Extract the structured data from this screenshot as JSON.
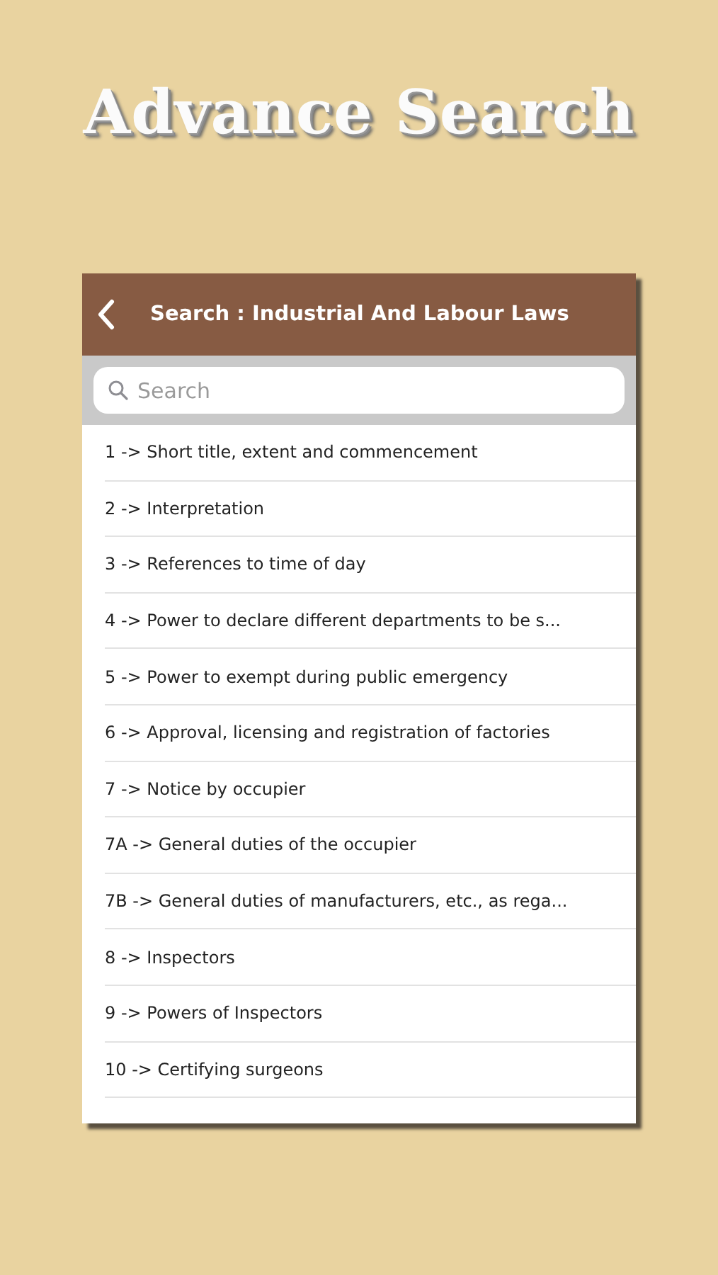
{
  "page_title": "Advance Search",
  "header": {
    "title": "Search : Industrial And Labour Laws"
  },
  "search": {
    "placeholder": "Search"
  },
  "items": [
    {
      "label": "1 -> Short title, extent and commencement"
    },
    {
      "label": "2 -> Interpretation"
    },
    {
      "label": "3 -> References to time of day"
    },
    {
      "label": "4 -> Power to declare different departments to be s..."
    },
    {
      "label": "5 -> Power to exempt during public emergency"
    },
    {
      "label": "6 -> Approval, licensing and registration of factories"
    },
    {
      "label": "7 -> Notice by occupier"
    },
    {
      "label": "7A -> General duties of the occupier"
    },
    {
      "label": "7B -> General duties of manufacturers, etc., as rega..."
    },
    {
      "label": "8 -> Inspectors"
    },
    {
      "label": "9 -> Powers of Inspectors"
    },
    {
      "label": "10 -> Certifying surgeons"
    }
  ]
}
